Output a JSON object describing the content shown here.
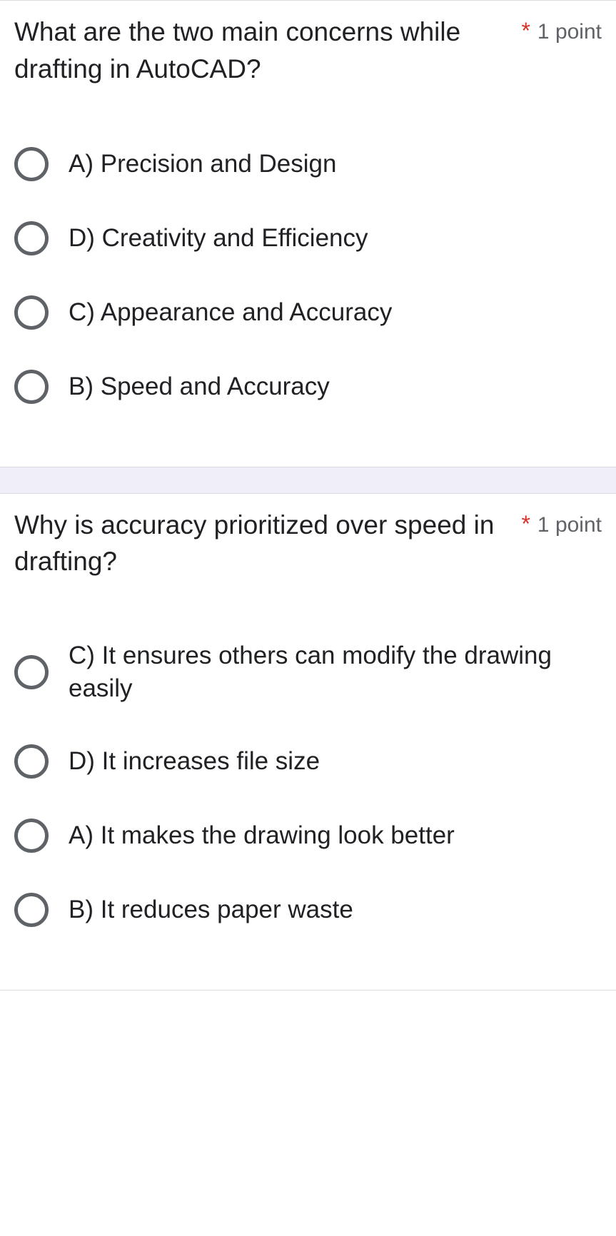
{
  "questions": [
    {
      "text": "What are the two main concerns while drafting in AutoCAD?",
      "required": "*",
      "points": "1 point",
      "options": [
        "A) Precision and Design",
        "D) Creativity and Efficiency",
        "C) Appearance and Accuracy",
        "B) Speed and Accuracy"
      ]
    },
    {
      "text": "Why is accuracy prioritized over speed in drafting?",
      "required": "*",
      "points": "1 point",
      "options": [
        "C) It ensures others can modify the drawing easily",
        "D) It increases file size",
        "A) It makes the drawing look better",
        "B) It reduces paper waste"
      ]
    }
  ]
}
